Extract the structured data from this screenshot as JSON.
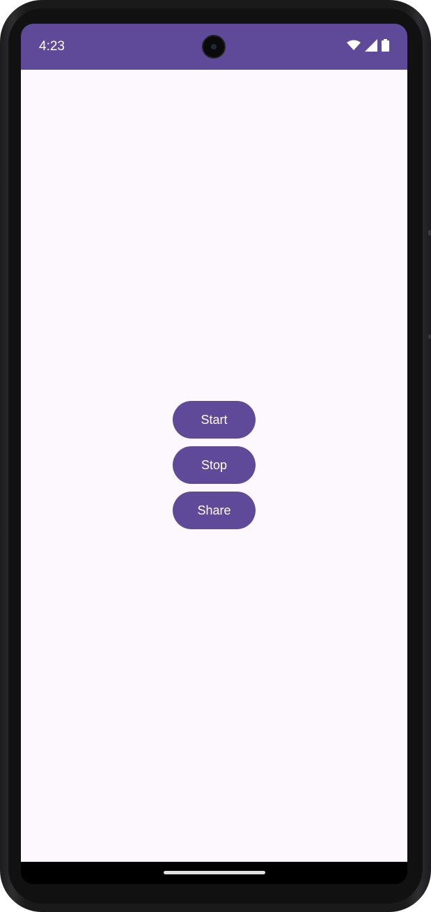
{
  "status_bar": {
    "time": "4:23",
    "icons": [
      "wifi-icon",
      "cellular-signal-icon",
      "battery-icon"
    ]
  },
  "buttons": {
    "start_label": "Start",
    "stop_label": "Stop",
    "share_label": "Share"
  },
  "colors": {
    "accent": "#5f4a9a",
    "background": "#fdf8fd",
    "on_accent": "#ffffff"
  }
}
